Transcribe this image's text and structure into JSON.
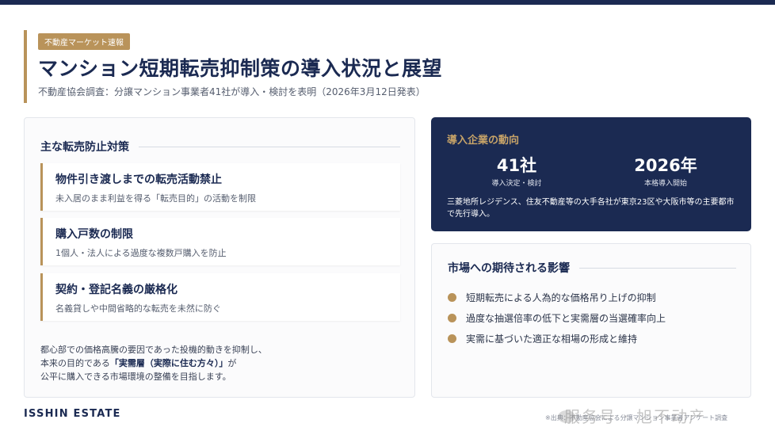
{
  "header": {
    "badge": "不動産マーケット速報",
    "title": "マンション短期転売抑制策の導入状況と展望",
    "subtitle": "不動産協会調査：分譲マンション事業者41社が導入・検討を表明（2026年3月12日発表）"
  },
  "measures": {
    "title": "主な転売防止対策",
    "items": [
      {
        "title": "物件引き渡しまでの転売活動禁止",
        "desc": "未入居のまま利益を得る「転売目的」の活動を制限"
      },
      {
        "title": "購入戸数の制限",
        "desc": "1個人・法人による過度な複数戸購入を防止"
      },
      {
        "title": "契約・登記名義の厳格化",
        "desc": "名義貸しや中間省略的な転売を未然に防ぐ"
      }
    ],
    "summary": {
      "line1": "都心部での価格高騰の要因であった投機的動きを抑制し、",
      "line2_pre": "本来の目的である",
      "line2_strong": "「実需層（実際に住む方々）」",
      "line2_post": "が",
      "line3": "公平に購入できる市場環境の整備を目指します。"
    }
  },
  "trends": {
    "title": "導入企業の動向",
    "stats": [
      {
        "value": "41社",
        "label": "導入決定・検討"
      },
      {
        "value": "2026年",
        "label": "本格導入開始"
      }
    ],
    "note": "三菱地所レジデンス、住友不動産等の大手各社が東京23区や大阪市等の主要都市で先行導入。"
  },
  "impact": {
    "title": "市場への期待される影響",
    "items": [
      "短期転売による人為的な価格吊り上げの抑制",
      "過度な抽選倍率の低下と実需層の当選確率向上",
      "実需に基づいた適正な相場の形成と維持"
    ]
  },
  "footer": {
    "brand": "ISSHIN ESTATE",
    "source": "※出典：不動産協会による分譲マンション事業者アンケート調査",
    "watermark": "服务号 · 旭不动产"
  },
  "colors": {
    "navy": "#1b2a52",
    "gold": "#b9935a"
  }
}
